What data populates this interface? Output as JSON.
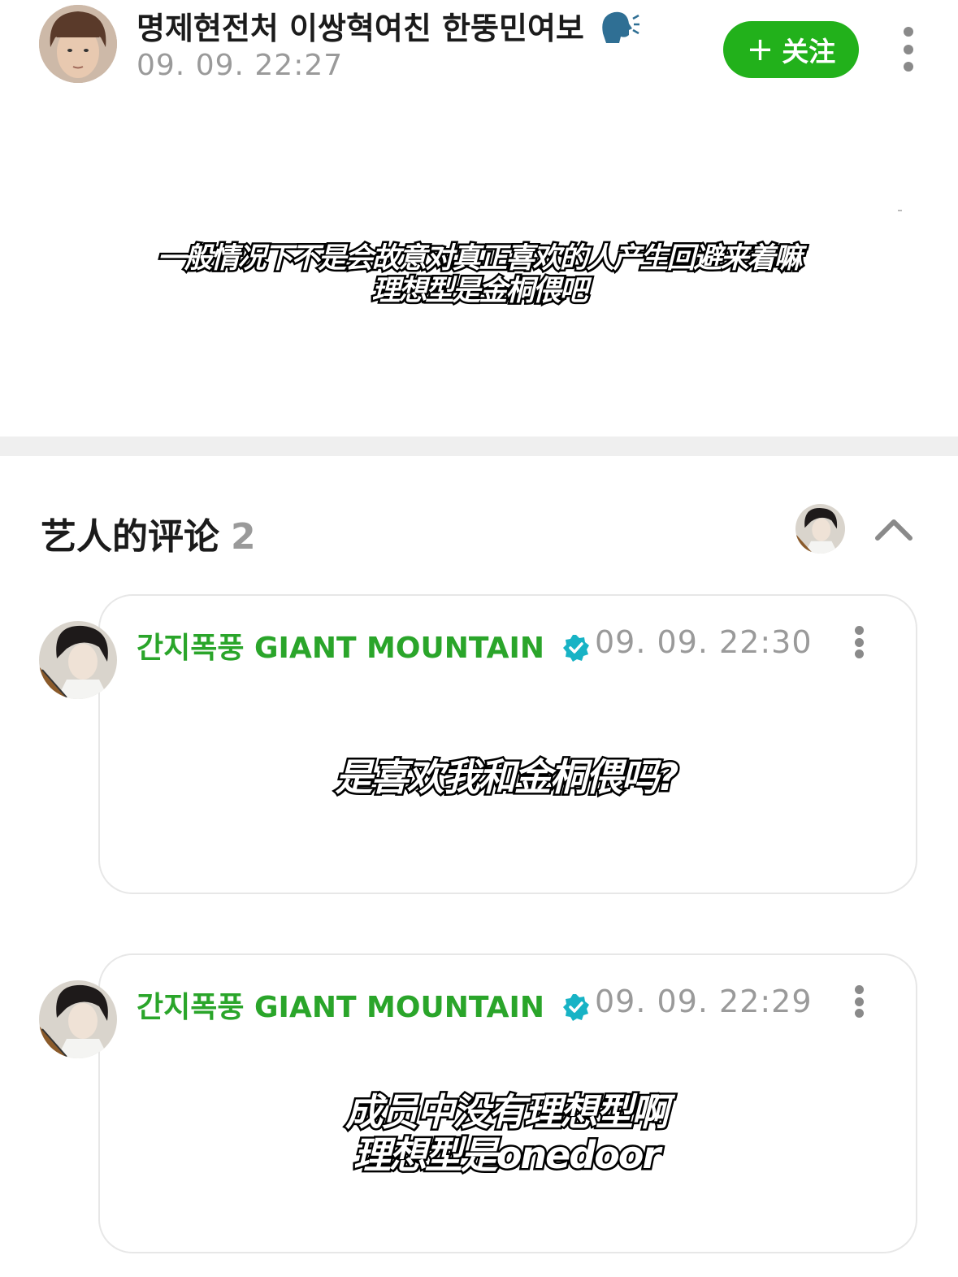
{
  "post": {
    "author_name": "명제현전처 이쌍혁여친 한뚱민여보",
    "author_icon": "speaking-head-icon",
    "time": "09. 09. 22:27",
    "follow_label": "关注",
    "caption_lines": [
      "一般情况下不是会故意对真正喜欢的人产生回避来着嘛",
      "理想型是金桐偎吧"
    ]
  },
  "comments_section": {
    "title": "艺人的评论",
    "count": "2"
  },
  "comments": [
    {
      "name": "간지폭풍 GIANT MOUNTAIN",
      "time": "09. 09. 22:30",
      "caption_lines": [
        "是喜欢我和金桐偎吗?"
      ]
    },
    {
      "name": "간지폭풍 GIANT MOUNTAIN",
      "time": "09. 09. 22:29",
      "caption_lines": [
        "成员中没有理想型啊",
        "理想型是onedoor"
      ]
    }
  ],
  "colors": {
    "accent_green": "#22b11b",
    "name_green": "#2aa52a",
    "verified_teal": "#18b3c5",
    "muted_gray": "#9a9a9a"
  }
}
